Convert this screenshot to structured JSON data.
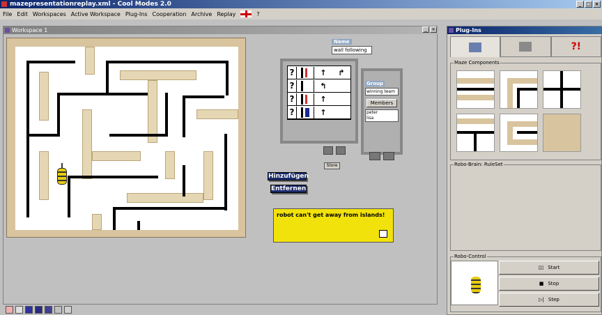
{
  "app": {
    "title": "mazepresentationreplay.xml - Cool Modes 2.0"
  },
  "menu": [
    "File",
    "Edit",
    "Workspaces",
    "Active Workspace",
    "Plug-Ins",
    "Cooperation",
    "Archive",
    "Replay",
    "?"
  ],
  "workspace": {
    "title": "Workspace 1"
  },
  "rules": {
    "name_label": "Name",
    "name_value": "wall following",
    "store_label": "Store",
    "add_label": "Hinzufügen",
    "remove_label": "Entfernen",
    "rows": [
      {
        "q": "?",
        "arrow": "↑",
        "arrow2": "↱"
      },
      {
        "q": "?",
        "arrow": "↰",
        "arrow2": ""
      },
      {
        "q": "?",
        "arrow": "↑",
        "arrow2": ""
      },
      {
        "q": "?",
        "arrow": "↑",
        "arrow2": ""
      }
    ]
  },
  "group": {
    "label": "Group",
    "value": "winning team",
    "members_label": "Members",
    "members": [
      "peter",
      "lisa"
    ]
  },
  "note": {
    "text": "robot can't get away from islands!"
  },
  "plugins": {
    "title": "Plug-Ins",
    "maze_components": "Maze Components",
    "rule_set": "Robo-Brain: RuleSet",
    "robo_control": "Robo-Control",
    "start": "Start",
    "stop": "Stop",
    "step": "Step"
  },
  "colors": {
    "note_bg": "#f2e20c",
    "stone": "#d8c49e",
    "titlebar": "#0a246a"
  }
}
